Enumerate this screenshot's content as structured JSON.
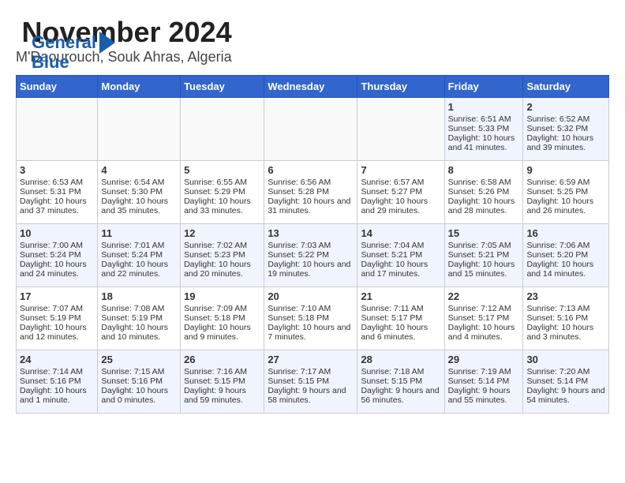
{
  "logo": {
    "line1": "General",
    "line2": "Blue"
  },
  "header": {
    "month": "November 2024",
    "location": "M'Daourouch, Souk Ahras, Algeria"
  },
  "days_of_week": [
    "Sunday",
    "Monday",
    "Tuesday",
    "Wednesday",
    "Thursday",
    "Friday",
    "Saturday"
  ],
  "weeks": [
    [
      {
        "day": "",
        "content": ""
      },
      {
        "day": "",
        "content": ""
      },
      {
        "day": "",
        "content": ""
      },
      {
        "day": "",
        "content": ""
      },
      {
        "day": "",
        "content": ""
      },
      {
        "day": "1",
        "content": "Sunrise: 6:51 AM\nSunset: 5:33 PM\nDaylight: 10 hours and 41 minutes."
      },
      {
        "day": "2",
        "content": "Sunrise: 6:52 AM\nSunset: 5:32 PM\nDaylight: 10 hours and 39 minutes."
      }
    ],
    [
      {
        "day": "3",
        "content": "Sunrise: 6:53 AM\nSunset: 5:31 PM\nDaylight: 10 hours and 37 minutes."
      },
      {
        "day": "4",
        "content": "Sunrise: 6:54 AM\nSunset: 5:30 PM\nDaylight: 10 hours and 35 minutes."
      },
      {
        "day": "5",
        "content": "Sunrise: 6:55 AM\nSunset: 5:29 PM\nDaylight: 10 hours and 33 minutes."
      },
      {
        "day": "6",
        "content": "Sunrise: 6:56 AM\nSunset: 5:28 PM\nDaylight: 10 hours and 31 minutes."
      },
      {
        "day": "7",
        "content": "Sunrise: 6:57 AM\nSunset: 5:27 PM\nDaylight: 10 hours and 29 minutes."
      },
      {
        "day": "8",
        "content": "Sunrise: 6:58 AM\nSunset: 5:26 PM\nDaylight: 10 hours and 28 minutes."
      },
      {
        "day": "9",
        "content": "Sunrise: 6:59 AM\nSunset: 5:25 PM\nDaylight: 10 hours and 26 minutes."
      }
    ],
    [
      {
        "day": "10",
        "content": "Sunrise: 7:00 AM\nSunset: 5:24 PM\nDaylight: 10 hours and 24 minutes."
      },
      {
        "day": "11",
        "content": "Sunrise: 7:01 AM\nSunset: 5:24 PM\nDaylight: 10 hours and 22 minutes."
      },
      {
        "day": "12",
        "content": "Sunrise: 7:02 AM\nSunset: 5:23 PM\nDaylight: 10 hours and 20 minutes."
      },
      {
        "day": "13",
        "content": "Sunrise: 7:03 AM\nSunset: 5:22 PM\nDaylight: 10 hours and 19 minutes."
      },
      {
        "day": "14",
        "content": "Sunrise: 7:04 AM\nSunset: 5:21 PM\nDaylight: 10 hours and 17 minutes."
      },
      {
        "day": "15",
        "content": "Sunrise: 7:05 AM\nSunset: 5:21 PM\nDaylight: 10 hours and 15 minutes."
      },
      {
        "day": "16",
        "content": "Sunrise: 7:06 AM\nSunset: 5:20 PM\nDaylight: 10 hours and 14 minutes."
      }
    ],
    [
      {
        "day": "17",
        "content": "Sunrise: 7:07 AM\nSunset: 5:19 PM\nDaylight: 10 hours and 12 minutes."
      },
      {
        "day": "18",
        "content": "Sunrise: 7:08 AM\nSunset: 5:19 PM\nDaylight: 10 hours and 10 minutes."
      },
      {
        "day": "19",
        "content": "Sunrise: 7:09 AM\nSunset: 5:18 PM\nDaylight: 10 hours and 9 minutes."
      },
      {
        "day": "20",
        "content": "Sunrise: 7:10 AM\nSunset: 5:18 PM\nDaylight: 10 hours and 7 minutes."
      },
      {
        "day": "21",
        "content": "Sunrise: 7:11 AM\nSunset: 5:17 PM\nDaylight: 10 hours and 6 minutes."
      },
      {
        "day": "22",
        "content": "Sunrise: 7:12 AM\nSunset: 5:17 PM\nDaylight: 10 hours and 4 minutes."
      },
      {
        "day": "23",
        "content": "Sunrise: 7:13 AM\nSunset: 5:16 PM\nDaylight: 10 hours and 3 minutes."
      }
    ],
    [
      {
        "day": "24",
        "content": "Sunrise: 7:14 AM\nSunset: 5:16 PM\nDaylight: 10 hours and 1 minute."
      },
      {
        "day": "25",
        "content": "Sunrise: 7:15 AM\nSunset: 5:16 PM\nDaylight: 10 hours and 0 minutes."
      },
      {
        "day": "26",
        "content": "Sunrise: 7:16 AM\nSunset: 5:15 PM\nDaylight: 9 hours and 59 minutes."
      },
      {
        "day": "27",
        "content": "Sunrise: 7:17 AM\nSunset: 5:15 PM\nDaylight: 9 hours and 58 minutes."
      },
      {
        "day": "28",
        "content": "Sunrise: 7:18 AM\nSunset: 5:15 PM\nDaylight: 9 hours and 56 minutes."
      },
      {
        "day": "29",
        "content": "Sunrise: 7:19 AM\nSunset: 5:14 PM\nDaylight: 9 hours and 55 minutes."
      },
      {
        "day": "30",
        "content": "Sunrise: 7:20 AM\nSunset: 5:14 PM\nDaylight: 9 hours and 54 minutes."
      }
    ]
  ]
}
